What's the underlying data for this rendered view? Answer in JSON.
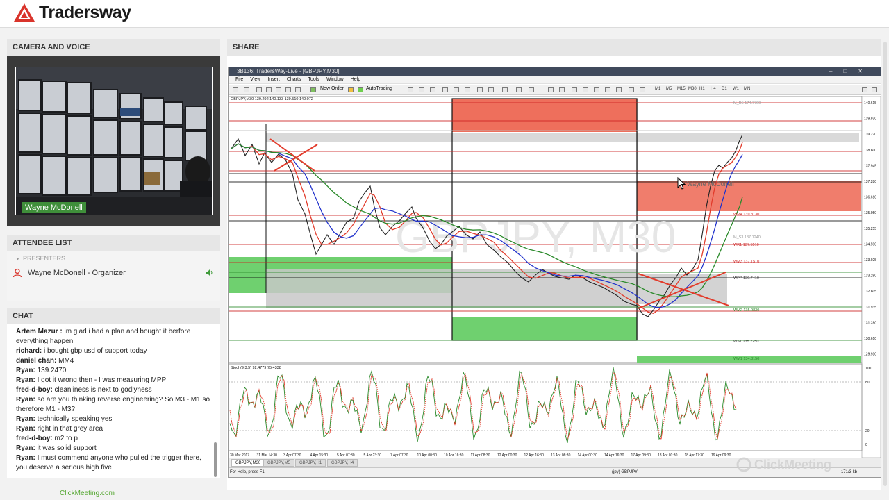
{
  "brand": {
    "name": "Tradersway"
  },
  "camera": {
    "title": "CAMERA AND VOICE",
    "presenter_name": "Wayne McDonell"
  },
  "attendees": {
    "title": "ATTENDEE LIST",
    "group_label": "PRESENTERS",
    "items": [
      {
        "name": "Wayne McDonell - Organizer"
      }
    ]
  },
  "chat": {
    "title": "CHAT",
    "messages": [
      {
        "author": "Artem Mazur :",
        "text": "im glad i had a plan and bought it berfore everything happen"
      },
      {
        "author": "richard:",
        "text": "i bought gbp usd of support today"
      },
      {
        "author": "daniel chan:",
        "text": "MM4"
      },
      {
        "author": "Ryan:",
        "text": "139.2470"
      },
      {
        "author": "Ryan:",
        "text": "I got it wrong then - I was measuring MPP"
      },
      {
        "author": "fred-d-boy:",
        "text": "cleanliness is next to godlyness"
      },
      {
        "author": "Ryan:",
        "text": "so are you thinking reverse engineering? So M3 - M1 so therefore M1 - M3?"
      },
      {
        "author": "Ryan:",
        "text": "technically speaking yes"
      },
      {
        "author": "Ryan:",
        "text": "right in that grey area"
      },
      {
        "author": "fred-d-boy:",
        "text": "m2 to p"
      },
      {
        "author": "Ryan:",
        "text": "it was solid support"
      },
      {
        "author": "Ryan:",
        "text": "I must commend anyone who pulled the trigger there, you deserve a serious high five"
      }
    ]
  },
  "footer": {
    "link": "ClickMeeting.com"
  },
  "share": {
    "title": "SHARE"
  },
  "mt4": {
    "window_title": "3B136: TradersWay-Live - [GBPJPY,M30]",
    "menu": [
      "File",
      "View",
      "Insert",
      "Charts",
      "Tools",
      "Window",
      "Help"
    ],
    "toolbar": {
      "new_order": "New Order",
      "auto_trading": "AutoTrading"
    },
    "timeframes": [
      "M1",
      "M5",
      "M15",
      "M30",
      "H1",
      "H4",
      "D1",
      "W1",
      "MN"
    ],
    "chart_header": "GBPJPY,M30  139.292 140.133 139.510 140.072",
    "watermark": "GBPJPY, M30",
    "osc_header": "Stoch(9,3,5) 92.4779 75.4338",
    "overlay_name": "Wayne McDonell",
    "levels": [
      {
        "label": "M_R5 174.7760",
        "color": "#999999"
      },
      {
        "label": "WM4 139.3130",
        "color": "#cc2222"
      },
      {
        "label": "WR1 137.5510",
        "color": "#cc2222"
      },
      {
        "label": "WM3 137.1510",
        "color": "#cc2222"
      },
      {
        "label": "WPP 136.7410",
        "color": "#333333"
      },
      {
        "label": "WM2 135.9830",
        "color": "#2a8a2a"
      },
      {
        "label": "WS1 135.2250",
        "color": "#333333"
      },
      {
        "label": "WM1 134.8150",
        "color": "#2a8a2a"
      },
      {
        "label": "M_S3 137.1240",
        "color": "#999999"
      }
    ],
    "price_axis": [
      "140.615",
      "139.930",
      "139.270",
      "138.600",
      "137.945",
      "137.280",
      "136.610",
      "135.950",
      "135.255",
      "134.590",
      "133.925",
      "133.250",
      "132.605",
      "131.935",
      "131.280",
      "130.610",
      "129.930"
    ],
    "time_axis": [
      "30 Mar 2017",
      "31 Mar 14:30",
      "3 Apr 07:30",
      "4 Apr 15:30",
      "5 Apr 07:30",
      "5 Apr 23:30",
      "7 Apr 07:30",
      "10 Apr 00:30",
      "10 Apr 16:30",
      "11 Apr 08:30",
      "12 Apr 00:30",
      "12 Apr 16:30",
      "13 Apr 08:30",
      "14 Apr 00:30",
      "14 Apr 16:30",
      "17 Apr 09:30",
      "18 Apr 01:30",
      "18 Apr 17:30",
      "19 Apr 09:30"
    ],
    "osc_axis": [
      "100",
      "80",
      "20",
      "0"
    ],
    "tabs": [
      "GBPJPY,M30",
      "GBPJPY,M5",
      "GBPJPY,H1",
      "GBPJPY,H4"
    ],
    "active_tab": 0,
    "status_help": "For Help, press F1",
    "status_symbol": "(jpy) GBPJPY",
    "status_time": "171/3 kb"
  },
  "watermark": {
    "text": "ClickMeeting"
  }
}
